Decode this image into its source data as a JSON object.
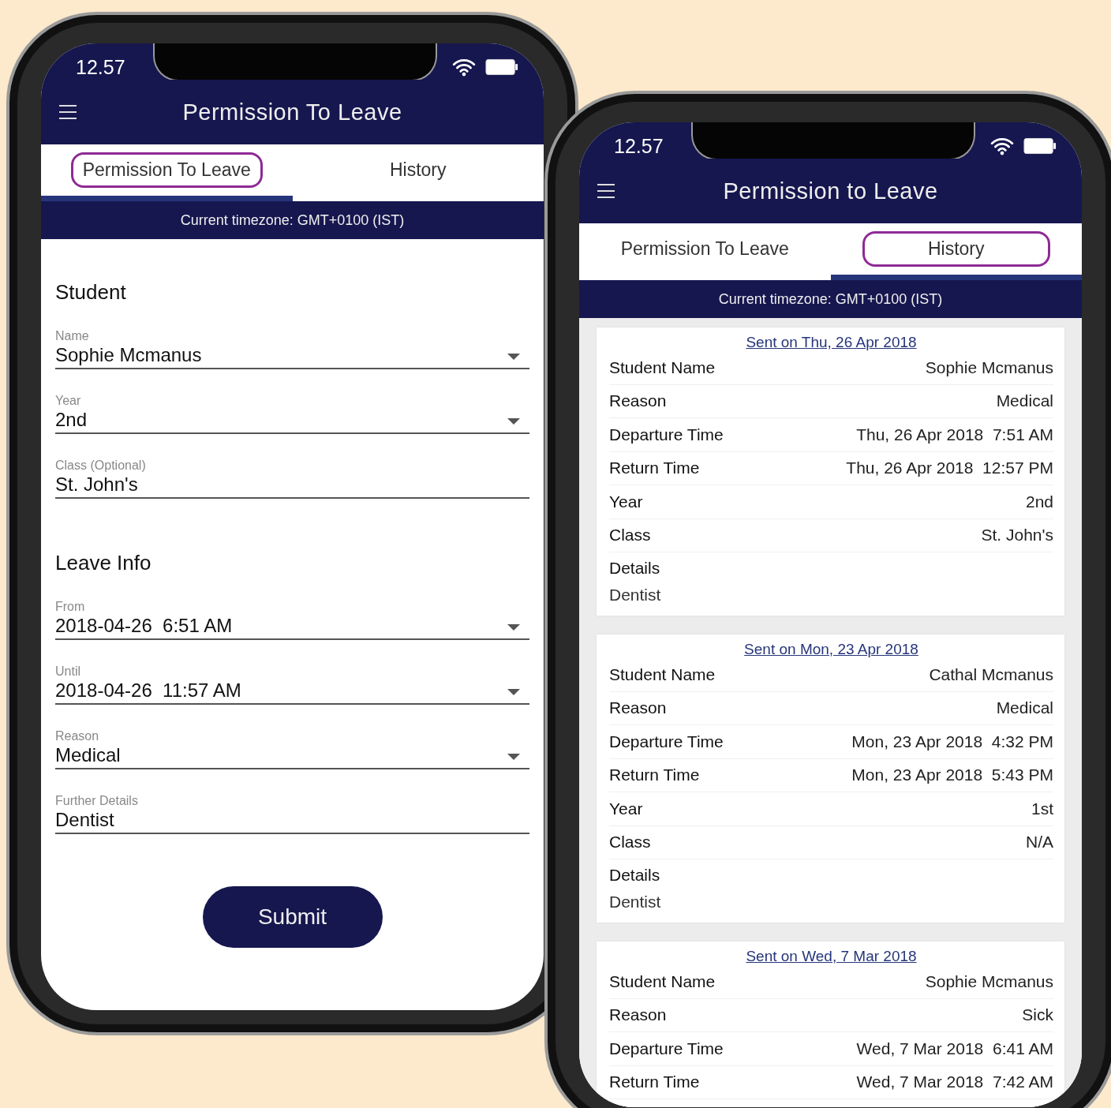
{
  "phones": [
    {
      "kind": "form",
      "status_bar": {
        "time": "12.57"
      },
      "app_bar": {
        "title": "Permission To Leave"
      },
      "tabs": [
        {
          "label": "Permission To Leave",
          "selected": true,
          "circled": true
        },
        {
          "label": "History",
          "selected": false,
          "circled": false
        }
      ],
      "timezone": "Current timezone: GMT+0100 (IST)",
      "sections": [
        {
          "heading": "Student",
          "fields": [
            {
              "label": "Name",
              "value": "Sophie Mcmanus",
              "dropdown": true
            },
            {
              "label": "Year",
              "value": "2nd",
              "dropdown": true
            },
            {
              "label": "Class (Optional)",
              "value": "St. John's",
              "dropdown": false
            }
          ]
        },
        {
          "heading": "Leave Info",
          "fields": [
            {
              "label": "From",
              "value": "2018-04-26  6:51 AM",
              "dropdown": true
            },
            {
              "label": "Until",
              "value": "2018-04-26  11:57 AM",
              "dropdown": true
            },
            {
              "label": "Reason",
              "value": "Medical",
              "dropdown": true
            },
            {
              "label": "Further Details",
              "value": "Dentist",
              "dropdown": false
            }
          ]
        }
      ],
      "submit": "Submit"
    },
    {
      "kind": "history",
      "status_bar": {
        "time": "12.57"
      },
      "app_bar": {
        "title": "Permission to Leave"
      },
      "tabs": [
        {
          "label": "Permission To Leave",
          "selected": false,
          "circled": false
        },
        {
          "label": "History",
          "selected": true,
          "circled": true
        }
      ],
      "timezone": "Current timezone: GMT+0100 (IST)",
      "entries": [
        {
          "sent": "Sent on Thu, 26 Apr 2018",
          "rows": [
            {
              "label": "Student Name",
              "value": "Sophie Mcmanus"
            },
            {
              "label": "Reason",
              "value": "Medical"
            },
            {
              "label": "Departure Time",
              "value": "Thu, 26 Apr 2018  7:51 AM"
            },
            {
              "label": "Return Time",
              "value": "Thu, 26 Apr 2018  12:57 PM"
            },
            {
              "label": "Year",
              "value": "2nd"
            },
            {
              "label": "Class",
              "value": "St. John's"
            }
          ],
          "details_label": "Details",
          "details": "Dentist"
        },
        {
          "sent": "Sent on Mon, 23 Apr 2018",
          "rows": [
            {
              "label": "Student Name",
              "value": "Cathal Mcmanus"
            },
            {
              "label": "Reason",
              "value": "Medical"
            },
            {
              "label": "Departure Time",
              "value": "Mon, 23 Apr 2018  4:32 PM"
            },
            {
              "label": "Return Time",
              "value": "Mon, 23 Apr 2018  5:43 PM"
            },
            {
              "label": "Year",
              "value": "1st"
            },
            {
              "label": "Class",
              "value": "N/A"
            }
          ],
          "details_label": "Details",
          "details": "Dentist"
        },
        {
          "sent": "Sent on Wed, 7 Mar 2018",
          "rows": [
            {
              "label": "Student Name",
              "value": "Sophie Mcmanus"
            },
            {
              "label": "Reason",
              "value": "Sick"
            },
            {
              "label": "Departure Time",
              "value": "Wed, 7 Mar 2018  6:41 AM"
            },
            {
              "label": "Return Time",
              "value": "Wed, 7 Mar 2018  7:42 AM"
            }
          ]
        }
      ]
    }
  ]
}
